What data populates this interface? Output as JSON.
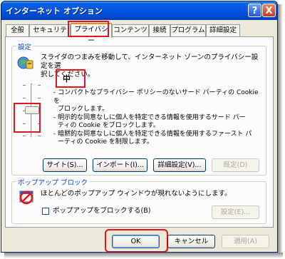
{
  "window": {
    "title": "インターネット オプション",
    "help_glyph": "?",
    "close_glyph": "X"
  },
  "tabs": [
    "全般",
    "セキュリティ",
    "プライバシー",
    "コンテンツ",
    "接続",
    "プログラム",
    "詳細設定"
  ],
  "active_tab": "プライバシー",
  "settings": {
    "group_label": "設定",
    "description_line1": "スライダのつまみを移動して、インターネット ゾーンのプライバシー設定を選",
    "description_line2": "択してください。",
    "level": "中",
    "level_description": [
      "- コンパクトなプライバシー ポリシーのないサード パーティの Cookie を",
      "ブロックします。",
      "- 明示的な同意なしに個人を特定できる情報を使用するサード パー",
      "ティの Cookie をブロックします。",
      "- 暗黙的な同意なしに個人を特定できる情報を使用するファースト パ",
      "ーティの Cookie を制限します。"
    ],
    "slider_level": 0.5,
    "buttons": {
      "sites": "サイト(S)...",
      "import": "インポート(I)...",
      "advanced": "詳細設定(V)...",
      "default": "既定(D)"
    }
  },
  "popup": {
    "group_label": "ポップアップ ブロック",
    "description": "ほとんどのポップアップ ウィンドウが現れないようにします。",
    "checkbox_label": "ポップアップをブロックする(B)",
    "checkbox_checked": false,
    "settings_button": "設定(E)..."
  },
  "footer": {
    "ok": "OK",
    "cancel": "キャンセル",
    "apply": "適用(A)"
  },
  "highlight_color": "#e3141b"
}
